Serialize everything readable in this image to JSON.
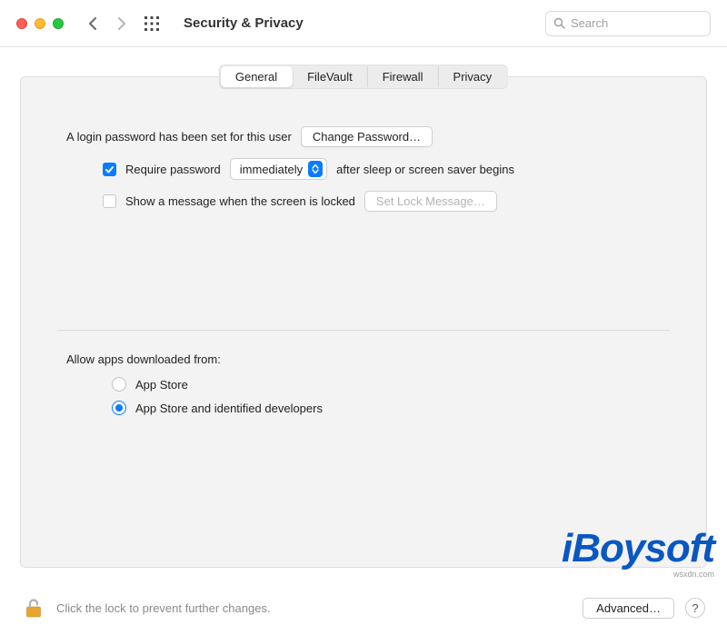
{
  "window": {
    "title": "Security & Privacy"
  },
  "search": {
    "placeholder": "Search"
  },
  "tabs": {
    "general": "General",
    "filevault": "FileVault",
    "firewall": "Firewall",
    "privacy": "Privacy"
  },
  "general": {
    "login_password_text": "A login password has been set for this user",
    "change_password_button": "Change Password…",
    "require_password_label": "Require password",
    "require_password_after": "after sleep or screen saver begins",
    "delay_options": {
      "selected": "immediately"
    },
    "show_message_label": "Show a message when the screen is locked",
    "set_lock_message_button": "Set Lock Message…",
    "allow_apps_label": "Allow apps downloaded from:",
    "allow_apps_options": {
      "app_store": "App Store",
      "app_store_and_dev": "App Store and identified developers"
    },
    "allow_apps_selected": "app_store_and_dev"
  },
  "footer": {
    "lock_text": "Click the lock to prevent further changes.",
    "advanced_button": "Advanced…",
    "help_label": "?"
  },
  "watermark": {
    "brand": "iBoysoft",
    "sub": "wsxdn.com"
  }
}
